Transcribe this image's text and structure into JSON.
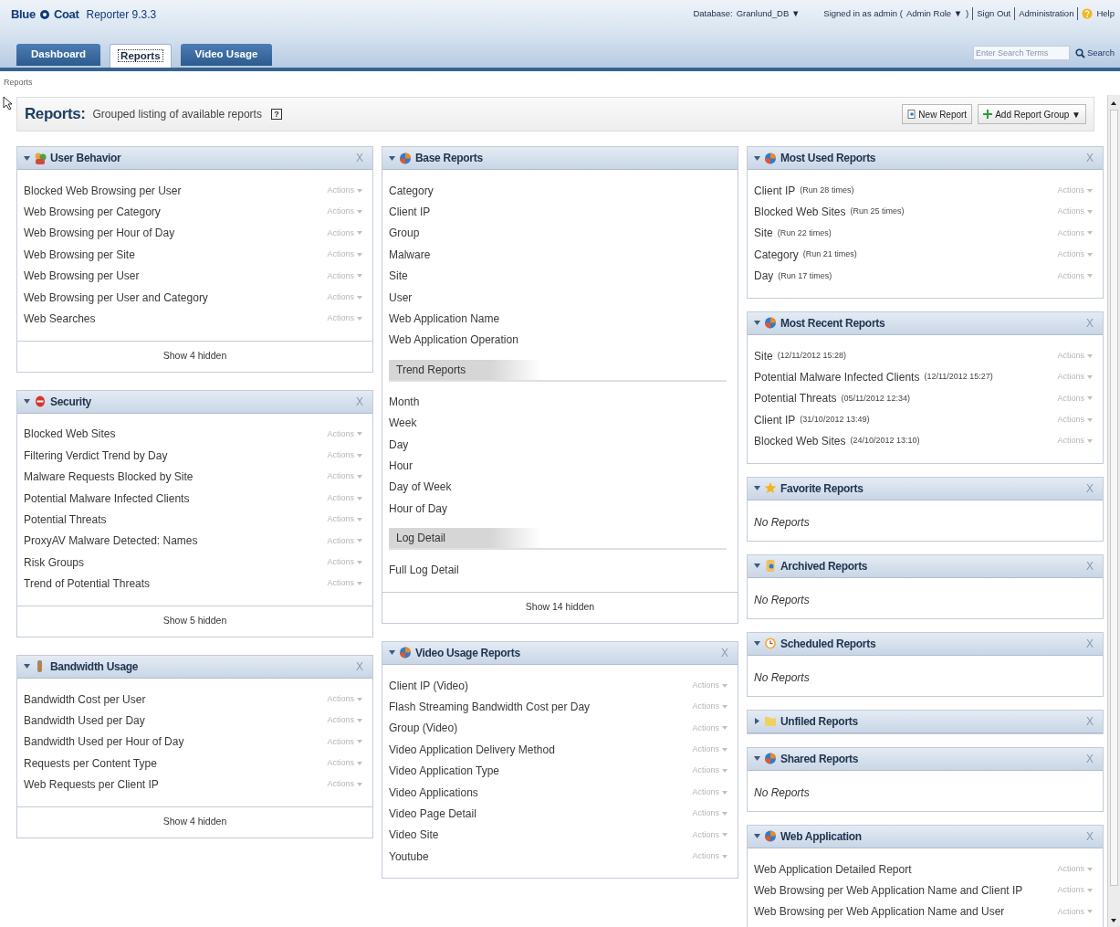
{
  "header": {
    "logo_left": "Blue",
    "logo_right": "Coat",
    "product": "Reporter 9.3.3",
    "database_label": "Database:",
    "database": "Granlund_DB ▼",
    "signed_in": "Signed in as admin (",
    "role": "Admin Role ▼",
    "signed_in_end": ")",
    "links": [
      "Sign Out",
      "Administration"
    ],
    "help": "Help",
    "search": {
      "placeholder": "Enter Search Terms",
      "button": "Search"
    }
  },
  "tabs": [
    {
      "label": "Dashboard",
      "selected": false
    },
    {
      "label": "Reports",
      "selected": true
    },
    {
      "label": "Video Usage",
      "selected": false
    }
  ],
  "breadcrumb": "Reports",
  "page_title": {
    "title": "Reports:",
    "subtitle": "Grouped listing of available reports",
    "help": "?",
    "buttons": [
      {
        "kind": "new",
        "label": "New Report"
      },
      {
        "kind": "add",
        "label": "Add Report Group ▼"
      }
    ]
  },
  "columns": [
    {
      "panels": [
        {
          "title": "User Behavior",
          "kind": "people",
          "expanded": true,
          "close": "X",
          "items": [
            {
              "label": "Blocked Web Browsing per User",
              "action": "Actions"
            },
            {
              "label": "Web Browsing per Category",
              "action": "Actions"
            },
            {
              "label": "Web Browsing per Hour of Day",
              "action": "Actions"
            },
            {
              "label": "Web Browsing per Site",
              "action": "Actions"
            },
            {
              "label": "Web Browsing per User",
              "action": "Actions"
            },
            {
              "label": "Web Browsing per User and Category",
              "action": "Actions"
            },
            {
              "label": "Web Searches",
              "action": "Actions"
            }
          ],
          "footer": "Show 4 hidden"
        },
        {
          "title": "Security",
          "kind": "no-entry",
          "expanded": true,
          "close": "X",
          "items": [
            {
              "label": "Blocked Web Sites",
              "action": "Actions"
            },
            {
              "label": "Filtering Verdict Trend by Day",
              "action": "Actions"
            },
            {
              "label": "Malware Requests Blocked by Site",
              "action": "Actions"
            },
            {
              "label": "Potential Malware Infected Clients",
              "action": "Actions"
            },
            {
              "label": "Potential Threats",
              "action": "Actions"
            },
            {
              "label": "ProxyAV Malware Detected: Names",
              "action": "Actions"
            },
            {
              "label": "Risk Groups",
              "action": "Actions"
            },
            {
              "label": "Trend of Potential Threats",
              "action": "Actions"
            }
          ],
          "footer": "Show 5 hidden"
        },
        {
          "title": "Bandwidth Usage",
          "kind": "thermometer",
          "expanded": true,
          "close": "X",
          "items": [
            {
              "label": "Bandwidth Cost per User",
              "action": "Actions"
            },
            {
              "label": "Bandwidth Used per Day",
              "action": "Actions"
            },
            {
              "label": "Bandwidth Used per Hour of Day",
              "action": "Actions"
            },
            {
              "label": "Requests per Content Type",
              "action": "Actions"
            },
            {
              "label": "Web Requests per Client IP",
              "action": "Actions"
            }
          ],
          "footer": "Show 4 hidden"
        }
      ]
    },
    {
      "panels": [
        {
          "title": "Base Reports",
          "kind": "globe",
          "expanded": true,
          "items": [
            {
              "kind": "link",
              "label": "Category"
            },
            {
              "kind": "link",
              "label": "Client IP"
            },
            {
              "kind": "link",
              "label": "Group"
            },
            {
              "kind": "link",
              "label": "Malware"
            },
            {
              "kind": "link",
              "label": "Site"
            },
            {
              "kind": "link",
              "label": "User"
            },
            {
              "kind": "link",
              "label": "Web Application Name"
            },
            {
              "kind": "link",
              "label": "Web Application Operation"
            },
            {
              "kind": "heading",
              "label": "Trend Reports"
            },
            {
              "kind": "link",
              "label": "Month"
            },
            {
              "kind": "link",
              "label": "Week"
            },
            {
              "kind": "link",
              "label": "Day"
            },
            {
              "kind": "link",
              "label": "Hour"
            },
            {
              "kind": "link",
              "label": "Day of Week"
            },
            {
              "kind": "link",
              "label": "Hour of Day"
            },
            {
              "kind": "heading",
              "label": "Log Detail"
            },
            {
              "kind": "link",
              "label": "Full Log Detail"
            }
          ],
          "footer": "Show 14 hidden"
        },
        {
          "title": "Video Usage Reports",
          "kind": "globe",
          "expanded": true,
          "close": "X",
          "items": [
            {
              "label": "Client IP (Video)",
              "action": "Actions"
            },
            {
              "label": "Flash Streaming Bandwidth Cost per Day",
              "action": "Actions"
            },
            {
              "label": "Group (Video)",
              "action": "Actions"
            },
            {
              "label": "Video Application Delivery Method",
              "action": "Actions"
            },
            {
              "label": "Video Application Type",
              "action": "Actions"
            },
            {
              "label": "Video Applications",
              "action": "Actions"
            },
            {
              "label": "Video Page Detail",
              "action": "Actions"
            },
            {
              "label": "Video Site",
              "action": "Actions"
            },
            {
              "label": "Youtube",
              "action": "Actions"
            }
          ]
        }
      ]
    },
    {
      "panels": [
        {
          "title": "Most Used Reports",
          "kind": "globe",
          "expanded": true,
          "close": "X",
          "items": [
            {
              "label": "Client IP",
              "note": "(Run 28 times)",
              "action": "Actions"
            },
            {
              "label": "Blocked Web Sites",
              "note": "(Run 25 times)",
              "action": "Actions"
            },
            {
              "label": "Site",
              "note": "(Run 22 times)",
              "action": "Actions"
            },
            {
              "label": "Category",
              "note": "(Run 21 times)",
              "action": "Actions"
            },
            {
              "label": "Day",
              "note": "(Run 17 times)",
              "action": "Actions"
            }
          ]
        },
        {
          "title": "Most Recent Reports",
          "kind": "globe",
          "expanded": true,
          "close": "X",
          "items": [
            {
              "label": "Site",
              "note": "(12/11/2012 15:28)",
              "action": "Actions"
            },
            {
              "label": "Potential Malware Infected Clients",
              "note": "(12/11/2012 15:27)",
              "action": "Actions"
            },
            {
              "label": "Potential Threats",
              "note": "(05/11/2012 12:34)",
              "action": "Actions"
            },
            {
              "label": "Client IP",
              "note": "(31/10/2012 13:49)",
              "action": "Actions"
            },
            {
              "label": "Blocked Web Sites",
              "note": "(24/10/2012 13:10)",
              "action": "Actions"
            }
          ]
        },
        {
          "title": "Favorite Reports",
          "kind": "star",
          "expanded": true,
          "close": "X",
          "empty": "No Reports"
        },
        {
          "title": "Archived Reports",
          "kind": "archive",
          "expanded": true,
          "close": "X",
          "empty": "No Reports"
        },
        {
          "title": "Scheduled Reports",
          "kind": "clock",
          "expanded": true,
          "close": "X",
          "empty": "No Reports"
        },
        {
          "title": "Unfiled Reports",
          "kind": "folder",
          "expanded": false,
          "close": "X"
        },
        {
          "title": "Shared Reports",
          "kind": "globe",
          "expanded": true,
          "close": "X",
          "empty": "No Reports"
        },
        {
          "title": "Web Application",
          "kind": "globe",
          "expanded": true,
          "close": "X",
          "items": [
            {
              "label": "Web Application Detailed Report",
              "action": "Actions"
            },
            {
              "label": "Web Browsing per Web Application Name and Client IP",
              "action": "Actions"
            },
            {
              "label": "Web Browsing per Web Application Name and User",
              "action": "Actions"
            }
          ]
        }
      ]
    }
  ]
}
